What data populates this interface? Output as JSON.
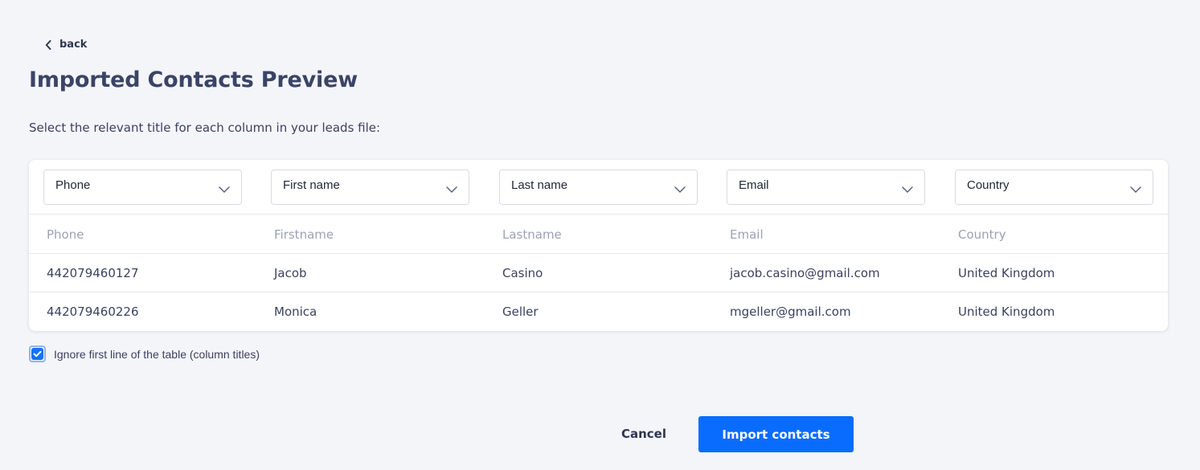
{
  "back": {
    "label": "back",
    "icon": "chevron-left-icon"
  },
  "title": "Imported Contacts Preview",
  "instructions": "Select the relevant title for each column in your leads file:",
  "column_selects": [
    {
      "value": "Phone"
    },
    {
      "value": "First name"
    },
    {
      "value": "Last name"
    },
    {
      "value": "Email"
    },
    {
      "value": "Country"
    }
  ],
  "table": {
    "headers": [
      "Phone",
      "Firstname",
      "Lastname",
      "Email",
      "Country"
    ],
    "rows": [
      [
        "442079460127",
        "Jacob",
        "Casino",
        "jacob.casino@gmail.com",
        "United Kingdom"
      ],
      [
        "442079460226",
        "Monica",
        "Geller",
        "mgeller@gmail.com",
        "United Kingdom"
      ]
    ]
  },
  "ignore_first_line": {
    "label": "Ignore first line of the table (column titles)",
    "checked": true
  },
  "actions": {
    "cancel_label": "Cancel",
    "import_label": "Import contacts"
  },
  "colors": {
    "accent": "#0a6cff",
    "background": "#f4f5f9",
    "title": "#3a4466"
  }
}
